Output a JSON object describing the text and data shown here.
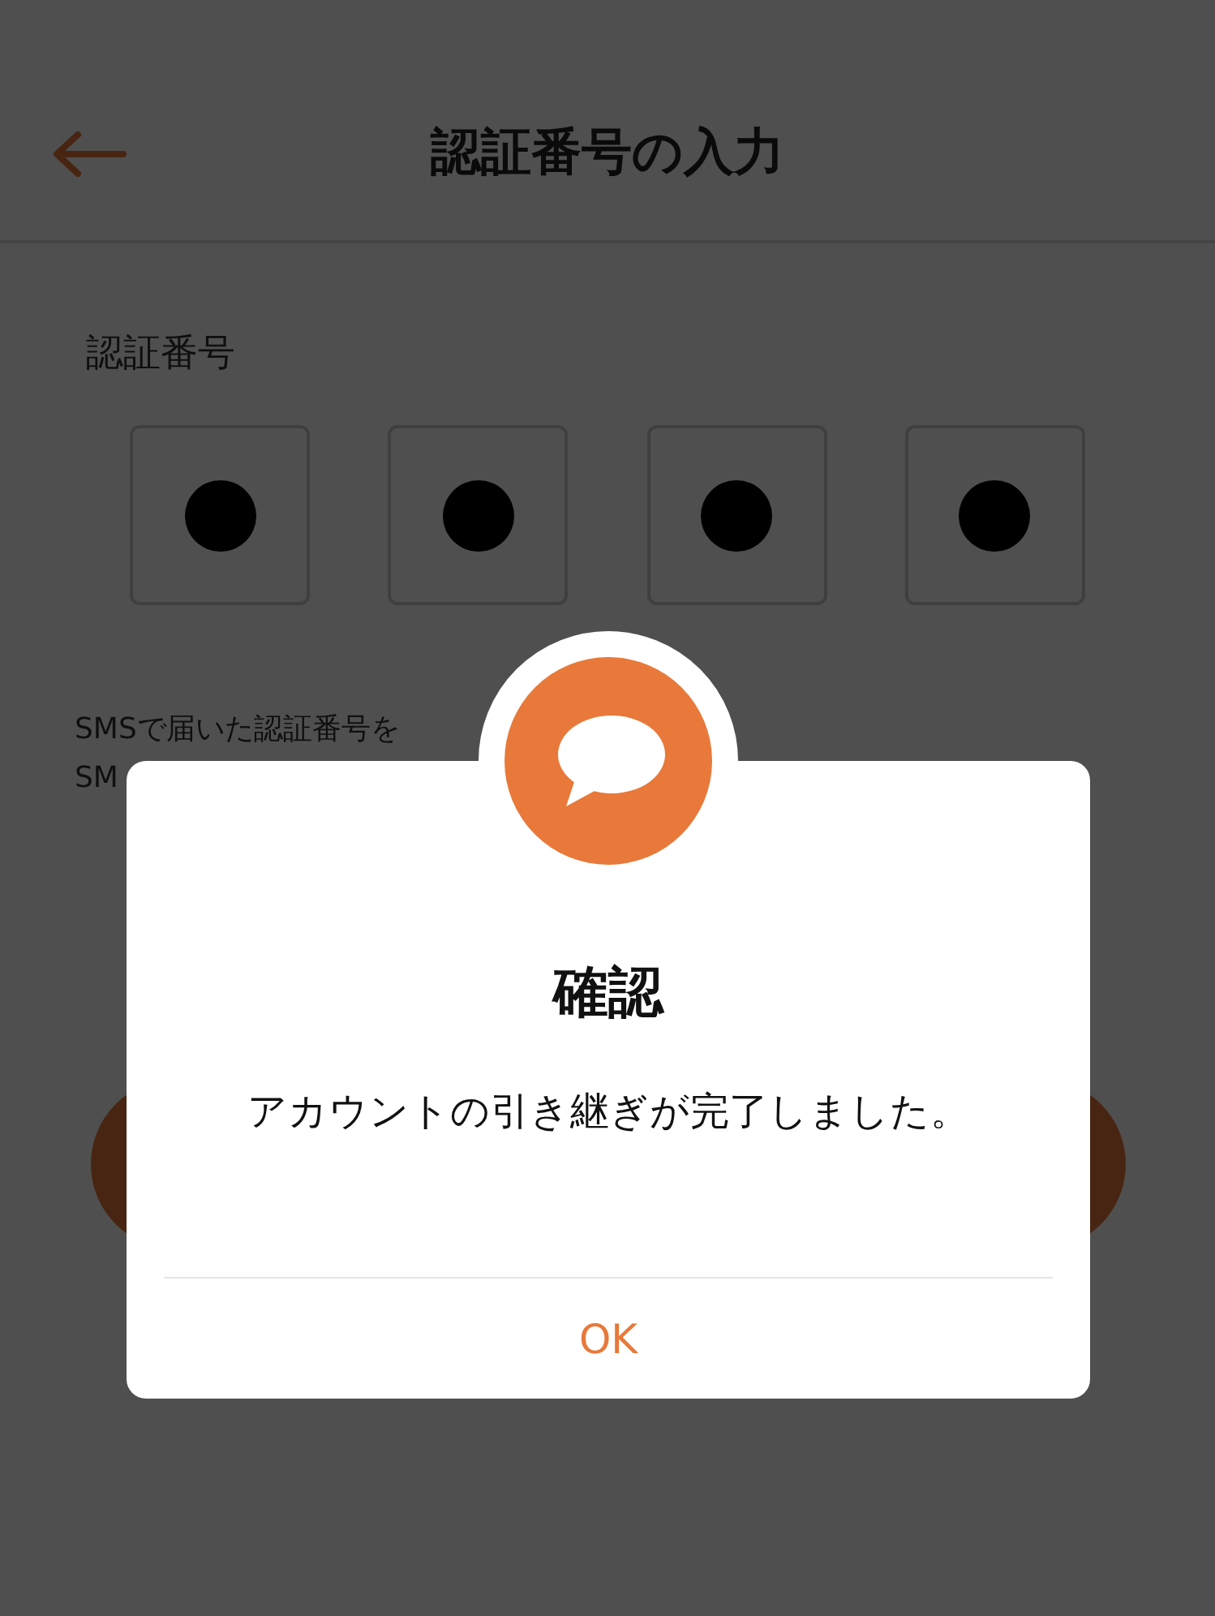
{
  "header": {
    "title": "認証番号の入力"
  },
  "code": {
    "label": "認証番号",
    "digits": [
      {
        "filled": true
      },
      {
        "filled": true
      },
      {
        "filled": true
      },
      {
        "filled": true
      }
    ]
  },
  "hint_lines": [
    "SMSで届いた認証番号を",
    "SM"
  ],
  "dialog": {
    "title": "確認",
    "message": "アカウントの引き継ぎが完了しました。",
    "buttons": [
      "OK"
    ]
  }
}
